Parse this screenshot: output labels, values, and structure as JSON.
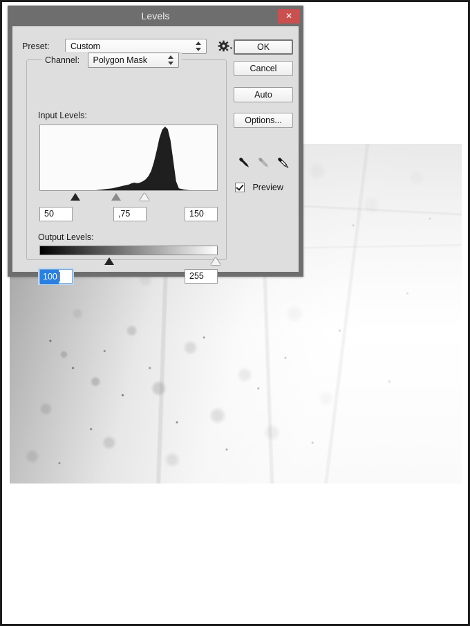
{
  "dialog": {
    "title": "Levels",
    "close_icon": "close-icon",
    "preset": {
      "label": "Preset:",
      "value": "Custom",
      "gear_icon": "gear-icon"
    },
    "channel": {
      "label": "Channel:",
      "value": "Polygon Mask"
    },
    "input_levels": {
      "label": "Input Levels:",
      "black_point": "50",
      "gamma": ",75",
      "white_point": "150",
      "black_marker_pct": 20,
      "gamma_marker_pct": 43,
      "white_marker_pct": 59
    },
    "output_levels": {
      "label": "Output Levels:",
      "black_point": "100",
      "white_point": "255",
      "black_marker_pct": 39,
      "white_marker_pct": 99
    },
    "buttons": {
      "ok": "OK",
      "cancel": "Cancel",
      "auto": "Auto",
      "options": "Options..."
    },
    "eyedroppers": {
      "black": "eyedropper-black-point-icon",
      "gray": "eyedropper-gray-point-icon",
      "white": "eyedropper-white-point-icon"
    },
    "preview": {
      "label": "Preview",
      "checked": true
    },
    "colors": {
      "titlebar": "#6e6e6e",
      "close_button": "#c9504e",
      "dialog_face": "#dedede",
      "selection_blue": "#2a7fe0",
      "focus_ring": "#bed8f0",
      "caret_orange": "#d2691e"
    }
  },
  "chart_data": {
    "type": "area",
    "title": "Input Levels histogram",
    "xlabel": "",
    "ylabel": "",
    "xlim": [
      0,
      255
    ],
    "ylim": [
      0,
      100
    ],
    "grid": false,
    "legend": "none",
    "x": [
      0,
      8,
      16,
      24,
      32,
      40,
      48,
      56,
      64,
      72,
      80,
      88,
      96,
      104,
      112,
      120,
      128,
      132,
      136,
      140,
      144,
      148,
      152,
      156,
      160,
      164,
      168,
      172,
      176,
      180,
      184,
      188,
      192,
      196,
      200,
      208,
      216,
      224,
      232,
      240,
      248,
      255
    ],
    "values": [
      0,
      0,
      0,
      0,
      0,
      0,
      0,
      0,
      0,
      0,
      0,
      1,
      2,
      3,
      5,
      7,
      9,
      11,
      12,
      11,
      12,
      14,
      17,
      22,
      30,
      44,
      62,
      82,
      95,
      100,
      96,
      78,
      46,
      14,
      3,
      1,
      0,
      0,
      0,
      0,
      0,
      0
    ]
  }
}
